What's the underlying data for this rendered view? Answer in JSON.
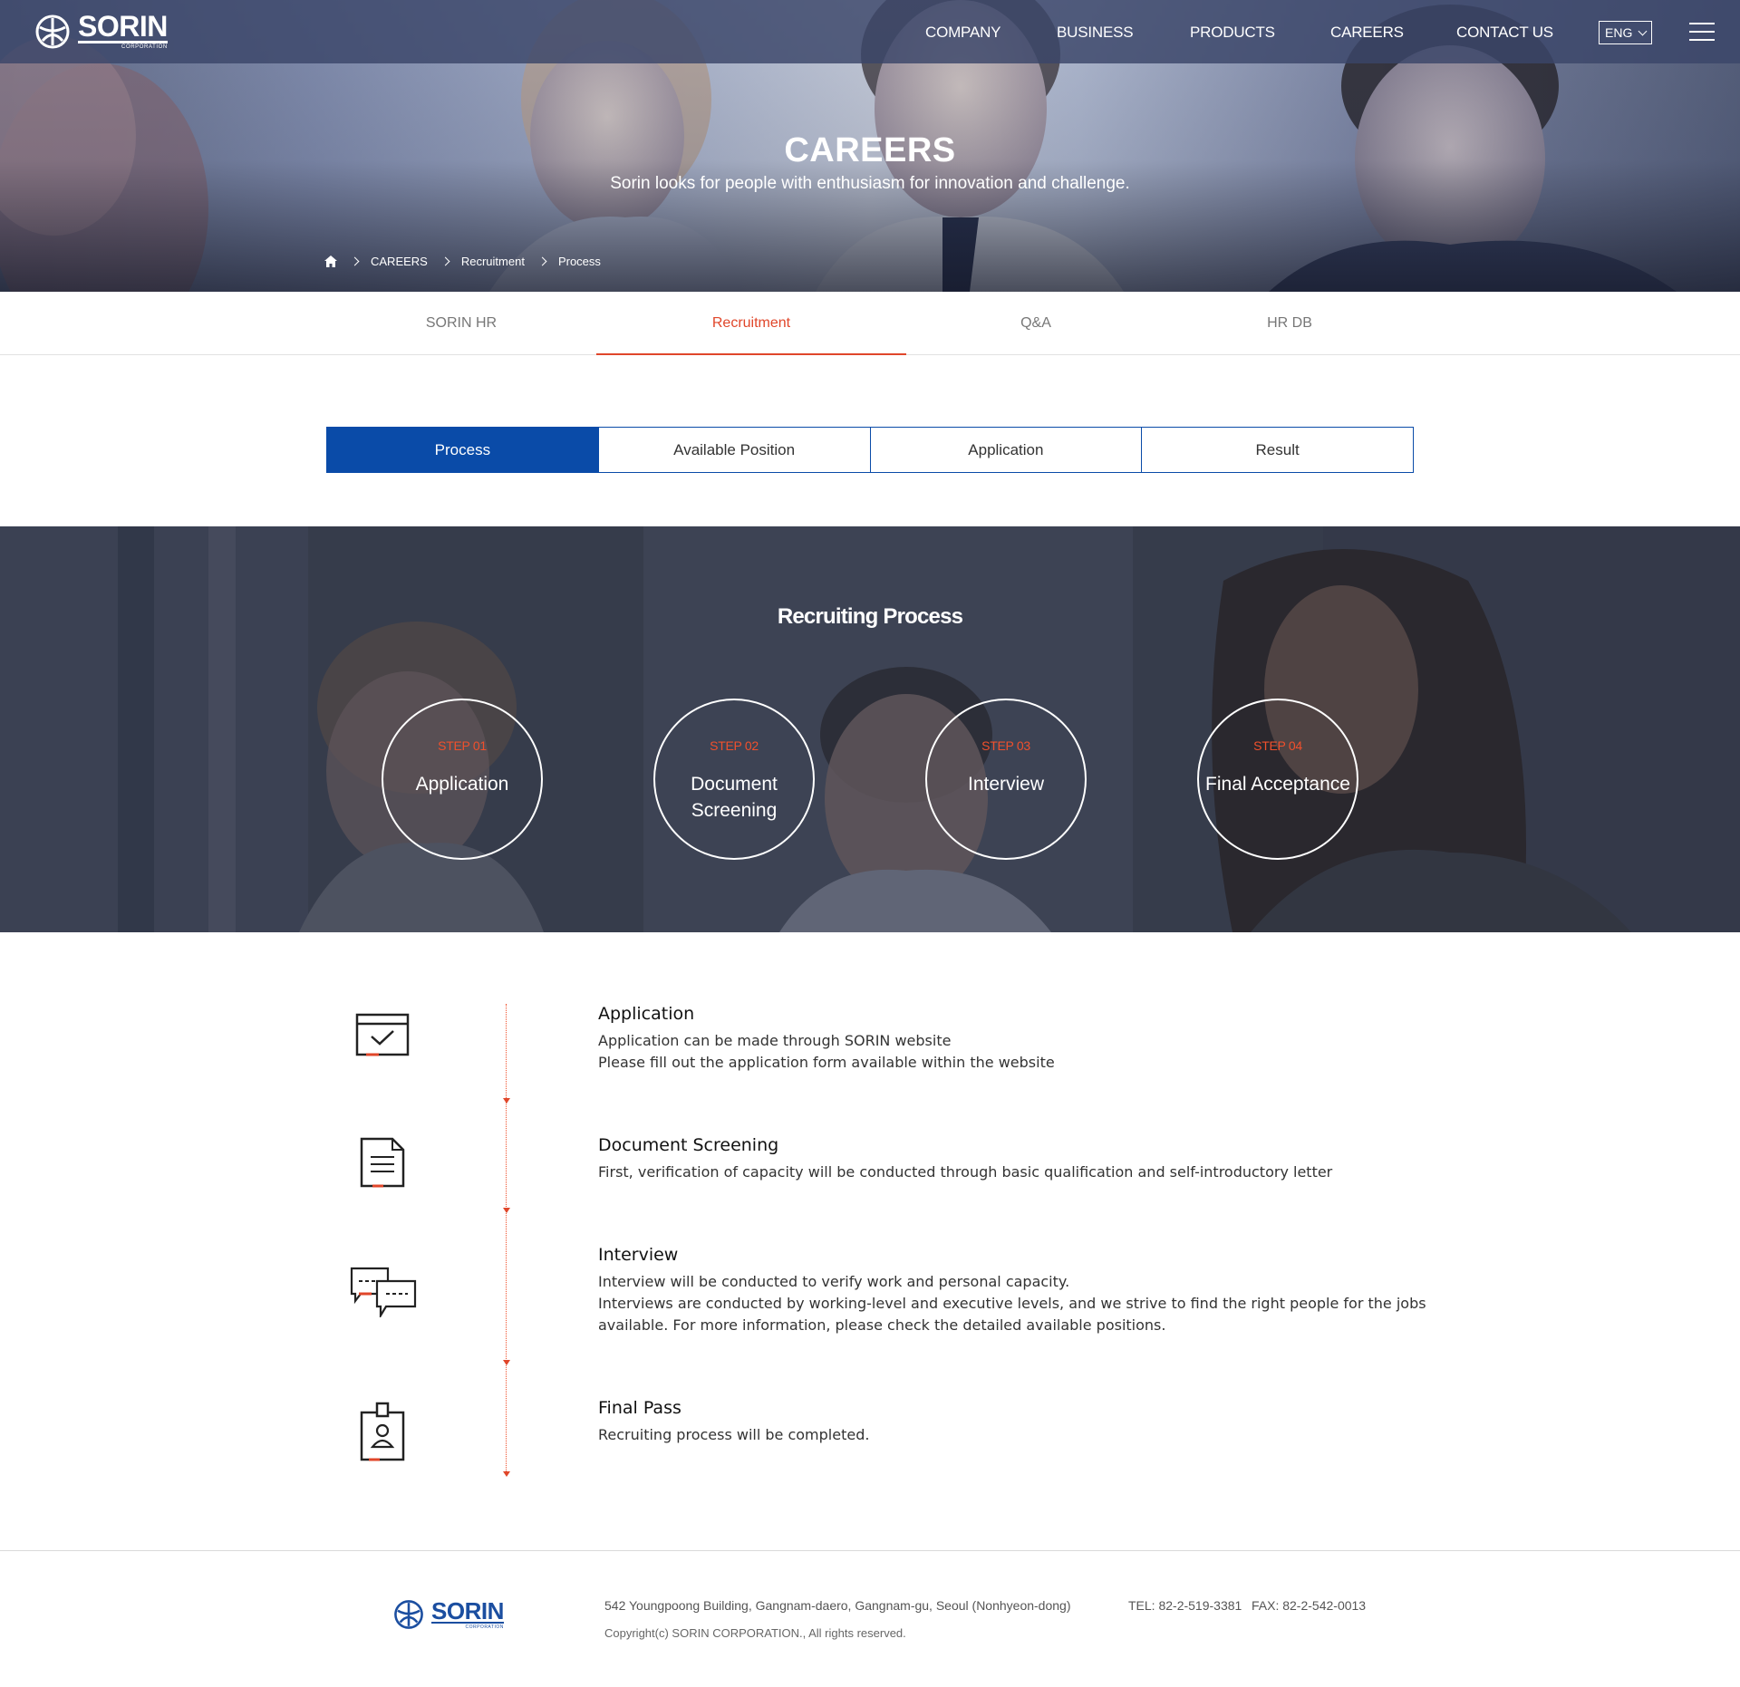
{
  "header": {
    "logo_text": "SORIN",
    "logo_sub": "CORPORATION",
    "nav": [
      "COMPANY",
      "BUSINESS",
      "PRODUCTS",
      "CAREERS",
      "CONTACT US"
    ],
    "lang": "ENG"
  },
  "hero": {
    "title": "CAREERS",
    "subtitle": "Sorin looks for people with enthusiasm for innovation and challenge.",
    "breadcrumb": [
      "CAREERS",
      "Recruitment",
      "Process"
    ]
  },
  "subtabs": [
    "SORIN HR",
    "Recruitment",
    "Q&A",
    "HR DB"
  ],
  "subtabs_active": "Recruitment",
  "process_tabs": [
    "Process",
    "Available Position",
    "Application",
    "Result"
  ],
  "process_tabs_active": "Process",
  "banner": {
    "title": "Recruiting Process",
    "steps": [
      {
        "step": "STEP 01",
        "name_line1": "Application",
        "name_line2": ""
      },
      {
        "step": "STEP 02",
        "name_line1": "Document",
        "name_line2": "Screening"
      },
      {
        "step": "STEP 03",
        "name_line1": "Interview",
        "name_line2": ""
      },
      {
        "step": "STEP 04",
        "name_line1": "Final Acceptance",
        "name_line2": ""
      }
    ]
  },
  "details": [
    {
      "icon": "application-form-icon",
      "title": "Application",
      "lines": [
        "Application can be made through SORIN website",
        "Please fill out the application form available within the website"
      ]
    },
    {
      "icon": "document-icon",
      "title": "Document Screening",
      "lines": [
        "First, verification of capacity will be conducted through basic qualification and self-introductory letter"
      ]
    },
    {
      "icon": "chat-bubbles-icon",
      "title": "Interview",
      "lines": [
        "Interview will be conducted to verify work and personal capacity.",
        "Interviews are conducted by working-level and executive levels, and we strive to find the right people for the jobs",
        "available. For more information, please check the detailed available positions."
      ]
    },
    {
      "icon": "id-badge-icon",
      "title": "Final Pass",
      "lines": [
        "Recruiting process will be completed."
      ]
    }
  ],
  "footer": {
    "logo_text": "SORIN",
    "logo_sub": "CORPORATION",
    "address": "542 Youngpoong Building, Gangnam-daero, Gangnam-gu, Seoul (Nonhyeon-dong)",
    "tel": "TEL: 82-2-519-3381",
    "fax": "FAX: 82-2-542-0013",
    "copyright": "Copyright(c) SORIN CORPORATION., All rights reserved."
  },
  "colors": {
    "accent": "#e0462a",
    "brand_blue": "#0a4ba8",
    "topbar": "#3a4669"
  }
}
